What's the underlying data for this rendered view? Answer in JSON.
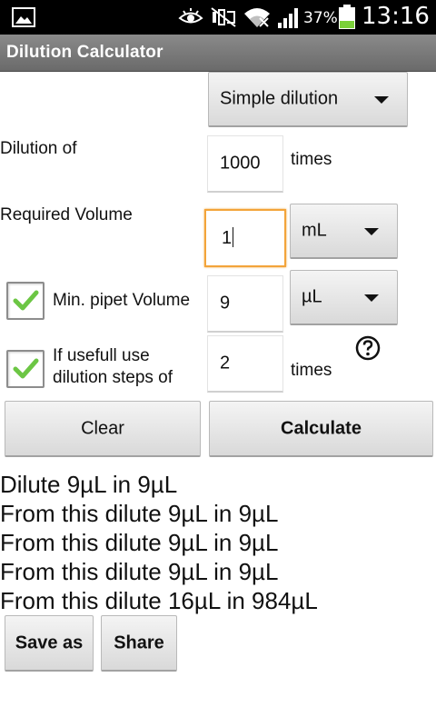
{
  "status_bar": {
    "icons": [
      "picture-icon",
      "eye-icon",
      "mute-icon",
      "wifi-icon",
      "signal-icon",
      "battery-icon"
    ],
    "battery": "37%",
    "battery_level": 0.37,
    "time": "13:16"
  },
  "app": {
    "title": "Dilution Calculator"
  },
  "mode_spinner": {
    "value": "Simple dilution"
  },
  "dilution_of": {
    "label": "Dilution of",
    "value": "1000",
    "unit": "times"
  },
  "required_volume": {
    "label": "Required Volume",
    "value": "1",
    "unit": "mL"
  },
  "min_pipet": {
    "checked": true,
    "label": "Min. pipet Volume",
    "value": "9",
    "unit": "µL"
  },
  "dilution_steps": {
    "checked": true,
    "label_line1": "If usefull use",
    "label_line2": "dilution steps of",
    "value": "2",
    "unit": "times"
  },
  "buttons": {
    "clear": "Clear",
    "calculate": "Calculate",
    "save_as": "Save as",
    "share": "Share"
  },
  "results": [
    "Dilute 9µL in 9µL",
    "From this dilute 9µL in 9µL",
    "From this dilute 9µL in 9µL",
    "From this dilute 9µL in 9µL",
    "From this dilute 16µL in 984µL"
  ],
  "colors": {
    "focus": "#f3a43a",
    "check": "#6cc644",
    "titlebar": "#7a7a7a",
    "battery": "#7bd13a"
  }
}
